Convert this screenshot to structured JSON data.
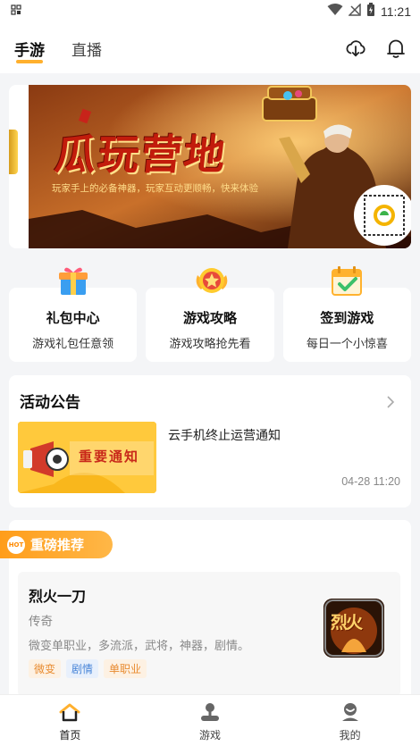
{
  "status": {
    "time": "11:21"
  },
  "header": {
    "tabs": [
      {
        "label": "手游",
        "active": true
      },
      {
        "label": "直播",
        "active": false
      }
    ]
  },
  "banner": {
    "title": "瓜玩营地",
    "subtitle": "玩家手上的必备神器，玩家互动更顺畅，快来体验"
  },
  "entries": [
    {
      "title": "礼包中心",
      "desc": "游戏礼包任意领",
      "icon": "gift-icon"
    },
    {
      "title": "游戏攻略",
      "desc": "游戏攻略抢先看",
      "icon": "guide-star-icon"
    },
    {
      "title": "签到游戏",
      "desc": "每日一个小惊喜",
      "icon": "calendar-check-icon"
    }
  ],
  "notice": {
    "title": "活动公告",
    "item_title": "云手机终止运营通知",
    "item_time": "04-28 11:20",
    "thumb_text": "重要通知"
  },
  "recommend": {
    "badge": "重磅推荐",
    "hot": "HOT",
    "game": {
      "name": "烈火一刀",
      "genre": "传奇",
      "desc": "微变单职业，多流派，武将，神器，剧情。",
      "logo_text": "烈火",
      "tags": [
        {
          "label": "微变",
          "color": "#e88b30",
          "bg": "#fdf1e3"
        },
        {
          "label": "剧情",
          "color": "#4a86d8",
          "bg": "#e8f0fc"
        },
        {
          "label": "单职业",
          "color": "#e88b30",
          "bg": "#fdf1e3"
        }
      ]
    }
  },
  "nav": [
    {
      "label": "首页",
      "active": true
    },
    {
      "label": "游戏",
      "active": false
    },
    {
      "label": "我的",
      "active": false
    }
  ],
  "colors": {
    "accent": "#ffb02e",
    "text": "#222222"
  }
}
